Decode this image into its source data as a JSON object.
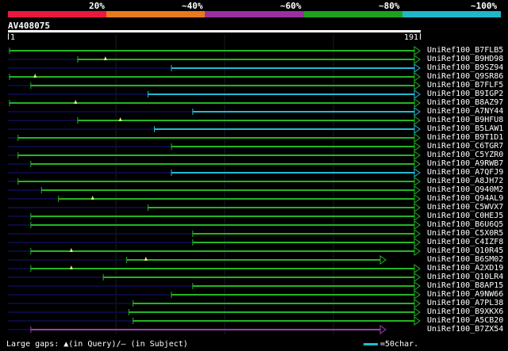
{
  "legend": {
    "labels": [
      "20%",
      "~40%",
      "~60%",
      "~80%",
      "~100%"
    ],
    "colors": [
      "#e8193d",
      "#e87a1e",
      "#9b2fa0",
      "#1fa01f",
      "#1fb8c8"
    ]
  },
  "query": {
    "id": "AV408075",
    "length_start": "1",
    "length_end": "191"
  },
  "hits": [
    {
      "id": "UniRef100_B7FLB5",
      "start": 1,
      "end": 191,
      "color": "#22b622",
      "marker": null
    },
    {
      "id": "UniRef100_B9HD98",
      "start": 33,
      "end": 191,
      "color": "#22b622",
      "marker": 46
    },
    {
      "id": "UniRef100_B9SZ94",
      "start": 77,
      "end": 191,
      "color": "#22bbd2",
      "marker": null
    },
    {
      "id": "UniRef100_Q9SR86",
      "start": 1,
      "end": 191,
      "color": "#22b622",
      "marker": 13
    },
    {
      "id": "UniRef100_B7FLF5",
      "start": 11,
      "end": 191,
      "color": "#22b622",
      "marker": null
    },
    {
      "id": "UniRef100_B9IGP2",
      "start": 66,
      "end": 191,
      "color": "#22bbd2",
      "marker": null
    },
    {
      "id": "UniRef100_B8AZ97",
      "start": 1,
      "end": 191,
      "color": "#22b622",
      "marker": 32
    },
    {
      "id": "UniRef100_A7NY44",
      "start": 87,
      "end": 191,
      "color": "#22bbd2",
      "marker": null
    },
    {
      "id": "UniRef100_B9HFU8",
      "start": 33,
      "end": 191,
      "color": "#22b622",
      "marker": 53
    },
    {
      "id": "UniRef100_B5LAW1",
      "start": 69,
      "end": 191,
      "color": "#22bbd2",
      "marker": null
    },
    {
      "id": "UniRef100_B9T1D1",
      "start": 5,
      "end": 191,
      "color": "#22b622",
      "marker": null
    },
    {
      "id": "UniRef100_C6TGR7",
      "start": 77,
      "end": 191,
      "color": "#22b622",
      "marker": null
    },
    {
      "id": "UniRef100_C5YZR0",
      "start": 5,
      "end": 191,
      "color": "#22b622",
      "marker": null
    },
    {
      "id": "UniRef100_A9RWB7",
      "start": 11,
      "end": 191,
      "color": "#22b622",
      "marker": null
    },
    {
      "id": "UniRef100_A7QFJ9",
      "start": 77,
      "end": 191,
      "color": "#22bbd2",
      "marker": null
    },
    {
      "id": "UniRef100_A8JH72",
      "start": 5,
      "end": 191,
      "color": "#22b622",
      "marker": null
    },
    {
      "id": "UniRef100_Q940M2",
      "start": 16,
      "end": 191,
      "color": "#22b622",
      "marker": null
    },
    {
      "id": "UniRef100_Q94AL9",
      "start": 24,
      "end": 191,
      "color": "#22b622",
      "marker": 40
    },
    {
      "id": "UniRef100_C5WVX7",
      "start": 66,
      "end": 191,
      "color": "#22b622",
      "marker": null
    },
    {
      "id": "UniRef100_C0HEJ5",
      "start": 11,
      "end": 191,
      "color": "#22b622",
      "marker": null
    },
    {
      "id": "UniRef100_B6U6Q5",
      "start": 11,
      "end": 191,
      "color": "#22b622",
      "marker": null
    },
    {
      "id": "UniRef100_C5X0R5",
      "start": 87,
      "end": 191,
      "color": "#22b622",
      "marker": null
    },
    {
      "id": "UniRef100_C4IZF8",
      "start": 87,
      "end": 191,
      "color": "#22b622",
      "marker": null
    },
    {
      "id": "UniRef100_Q10R45",
      "start": 11,
      "end": 191,
      "color": "#22b622",
      "marker": 30
    },
    {
      "id": "UniRef100_B6SM02",
      "start": 56,
      "end": 175,
      "color": "#22b622",
      "marker": 65
    },
    {
      "id": "UniRef100_A2XD19",
      "start": 11,
      "end": 191,
      "color": "#22b622",
      "marker": 30
    },
    {
      "id": "UniRef100_Q10LR4",
      "start": 45,
      "end": 191,
      "color": "#22b622",
      "marker": null
    },
    {
      "id": "UniRef100_B8AP15",
      "start": 87,
      "end": 191,
      "color": "#22b622",
      "marker": null
    },
    {
      "id": "UniRef100_A9NW66",
      "start": 77,
      "end": 191,
      "color": "#22b622",
      "marker": null
    },
    {
      "id": "UniRef100_A7PL38",
      "start": 59,
      "end": 191,
      "color": "#22b622",
      "marker": null
    },
    {
      "id": "UniRef100_B9XKX6",
      "start": 57,
      "end": 191,
      "color": "#22b622",
      "marker": null
    },
    {
      "id": "UniRef100_A5CB20",
      "start": 59,
      "end": 191,
      "color": "#22b622",
      "marker": null
    },
    {
      "id": "UniRef100_B7ZX54",
      "start": 11,
      "end": 175,
      "color": "#a040b0",
      "marker": null
    }
  ],
  "footer": {
    "gaps_label": "Large gaps: ▲(in Query)/– (in Subject)",
    "scale_label": "=50char.",
    "scale_color": "#22bbd2"
  }
}
